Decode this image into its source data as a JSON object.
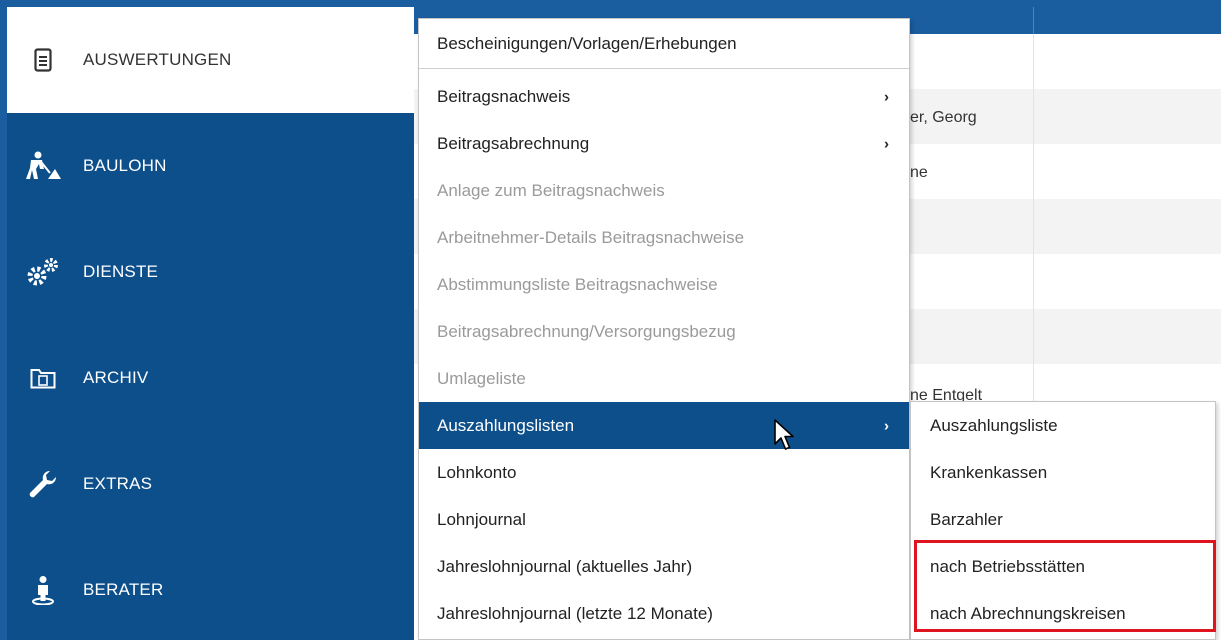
{
  "sidebar": {
    "items": [
      {
        "label": "AUSWERTUNGEN",
        "icon": "document-icon",
        "active": true
      },
      {
        "label": "BAULOHN",
        "icon": "construction-worker-icon"
      },
      {
        "label": "DIENSTE",
        "icon": "gears-icon"
      },
      {
        "label": "ARCHIV",
        "icon": "folder-icon"
      },
      {
        "label": "EXTRAS",
        "icon": "wrench-icon"
      },
      {
        "label": "BERATER",
        "icon": "advisor-icon"
      }
    ]
  },
  "background": {
    "cells": [
      "er, Georg",
      "ne",
      "ne Entgelt"
    ]
  },
  "menu": {
    "items": [
      {
        "label": "Bescheinigungen/Vorlagen/Erhebungen",
        "state": "header"
      },
      {
        "label": "Beitragsnachweis",
        "submenu": true
      },
      {
        "label": "Beitragsabrechnung",
        "submenu": true
      },
      {
        "label": "Anlage zum Beitragsnachweis",
        "state": "disabled"
      },
      {
        "label": "Arbeitnehmer-Details Beitragsnachweise",
        "state": "disabled"
      },
      {
        "label": "Abstimmungsliste Beitragsnachweise",
        "state": "disabled"
      },
      {
        "label": "Beitragsabrechnung/Versorgungsbezug",
        "state": "disabled"
      },
      {
        "label": "Umlageliste",
        "state": "disabled"
      },
      {
        "label": "Auszahlungslisten",
        "submenu": true,
        "state": "highlighted"
      },
      {
        "label": "Lohnkonto"
      },
      {
        "label": "Lohnjournal"
      },
      {
        "label": "Jahreslohnjournal (aktuelles Jahr)"
      },
      {
        "label": "Jahreslohnjournal (letzte 12 Monate)"
      }
    ],
    "arrow_glyph": "›"
  },
  "submenu": {
    "items": [
      {
        "label": "Auszahlungsliste"
      },
      {
        "label": "Krankenkassen"
      },
      {
        "label": "Barzahler"
      },
      {
        "label": "nach Betriebsstätten"
      },
      {
        "label": "nach Abrechnungskreisen"
      }
    ]
  },
  "colors": {
    "sidebar_bg": "#0d4f8b",
    "highlight_bg": "#0d4f8b",
    "annotation_red": "#e0141e"
  }
}
